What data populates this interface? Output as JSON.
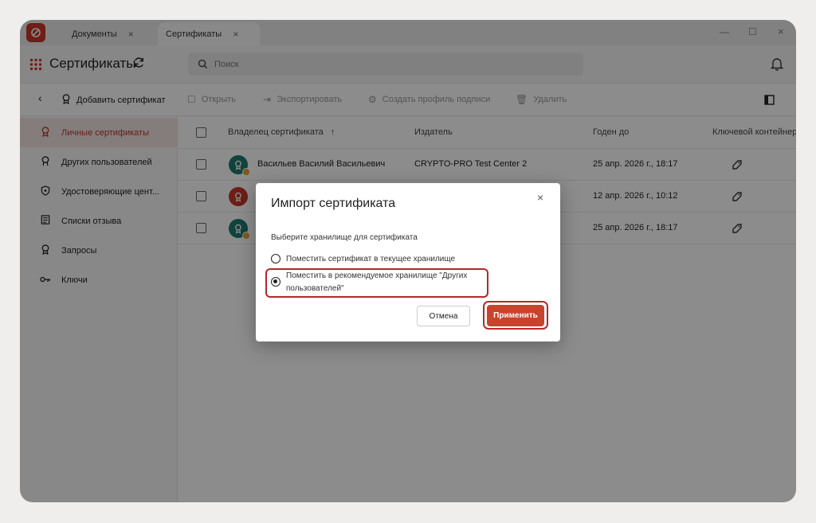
{
  "window": {
    "tabs": [
      {
        "label": "Документы",
        "close": "×"
      },
      {
        "label": "Сертификаты",
        "close": "×"
      }
    ],
    "controls": {
      "minimize": "—",
      "maximize": "☐",
      "close": "×"
    }
  },
  "header": {
    "title": "Сертификаты",
    "search_placeholder": "Поиск"
  },
  "toolbar": {
    "back": "‹",
    "add": "Добавить сертификат",
    "open": "Открыть",
    "export": "Экспортировать",
    "create_profile": "Создать профиль подписи",
    "delete": "Удалить"
  },
  "sidebar": {
    "items": [
      {
        "label": "Личные сертификаты",
        "icon": "certificate-icon",
        "active": true
      },
      {
        "label": "Других пользователей",
        "icon": "user-icon"
      },
      {
        "label": "Удостоверяющие цент...",
        "icon": "shield-icon"
      },
      {
        "label": "Списки отзыва",
        "icon": "list-icon"
      },
      {
        "label": "Запросы",
        "icon": "request-icon"
      },
      {
        "label": "Ключи",
        "icon": "key-icon"
      }
    ]
  },
  "table": {
    "columns": {
      "owner": "Владелец сертификата",
      "sort": "↑",
      "issuer": "Издатель",
      "valid_to": "Годен до",
      "container": "Ключевой контейнер"
    },
    "rows": [
      {
        "owner": "Васильев Василий Васильевич",
        "issuer": "CRYPTO-PRO Test Center 2",
        "valid_to": "25 апр. 2026 г., 18:17",
        "avatar_color": "#1d7a6c"
      },
      {
        "owner": "",
        "issuer": "",
        "valid_to": "12 апр. 2026 г., 10:12",
        "avatar_color": "#c8352a"
      },
      {
        "owner": "",
        "issuer": "",
        "valid_to": "25 апр. 2026 г., 18:17",
        "avatar_color": "#1d7a6c"
      }
    ]
  },
  "dialog": {
    "title": "Импорт сертификата",
    "close": "×",
    "subtitle": "Выберите хранилище для сертификата",
    "option1": "Поместить сертификат в текущее хранилище",
    "option2_line1": "Поместить в рекомендуемое хранилище \"Других",
    "option2_line2": "пользователей\"",
    "cancel": "Отмена",
    "apply": "Применить"
  },
  "colors": {
    "accent": "#c8352a",
    "highlight": "#b3282a",
    "teal": "#1d7a6c"
  }
}
